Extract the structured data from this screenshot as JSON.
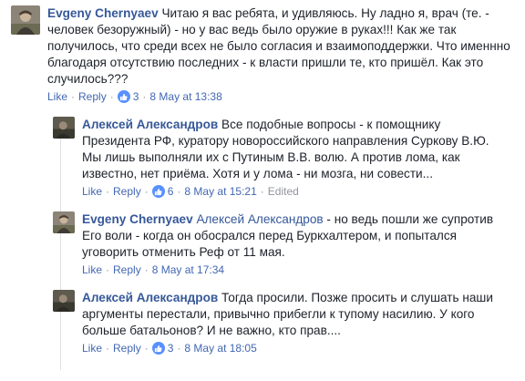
{
  "comments": [
    {
      "author": "Evgeny Chernyaev",
      "text": "Читаю я вас ребята, и удивляюсь. Ну ладно я, врач (те. - человек безоружный) - но у вас ведь было оружие в руках!!! Как же так получилось, что среди всех не было согласия и взаимоподдержки. Что именнно благодаря отсутствию последних - к власти пришли те, кто пришёл. Как это случилось???",
      "like_label": "Like",
      "reply_label": "Reply",
      "reactions": "3",
      "timestamp": "8 May at 13:38"
    },
    {
      "author": "Алексей Александров",
      "text": "Все подобные вопросы - к помощнику Президента РФ, куратору новороссийского направления Суркову В.Ю. Мы лишь выполняли их с Путиным В.В. волю. А против лома, как известно, нет приёма. Хотя и у лома - ни мозга, ни совести...",
      "like_label": "Like",
      "reply_label": "Reply",
      "reactions": "6",
      "timestamp": "8 May at 15:21",
      "edited": "Edited"
    },
    {
      "author": "Evgeny Chernyaev",
      "mention": "Алексей Александров",
      "text": "- но ведь пошли же супротив Его воли - когда он обосрался перед Буркхалтером, и попытался уговорить отменить Реф от 11 мая.",
      "like_label": "Like",
      "reply_label": "Reply",
      "timestamp": "8 May at 17:34"
    },
    {
      "author": "Алексей Александров",
      "text": "Тогда просили. Позже просить и слушать наши аргументы перестали, привычно прибегли к тупому насилию. У кого больше батальонов? И не важно, кто прав....",
      "like_label": "Like",
      "reply_label": "Reply",
      "reactions": "3",
      "timestamp": "8 May at 18:05"
    }
  ],
  "separator": "·",
  "colors": {
    "author": "#365899",
    "link": "#4267b2",
    "meta": "#90949c",
    "like_badge": "#5890ff"
  }
}
